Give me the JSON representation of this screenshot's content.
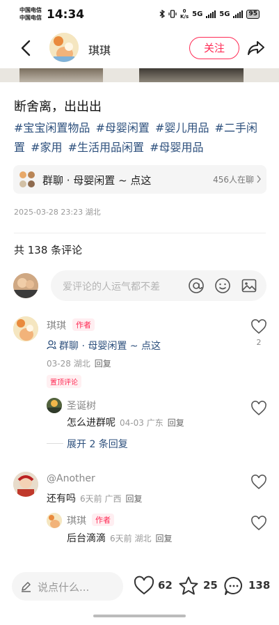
{
  "status": {
    "carrier1": "中国电信",
    "carrier2": "中国电信",
    "time": "14:34",
    "net_speed": "0",
    "net_unit": "K/s",
    "net1": "5G",
    "net2": "5G",
    "battery": "95"
  },
  "header": {
    "author_name": "琪琪",
    "follow_label": "关注"
  },
  "post": {
    "title": "断舍离，出出出",
    "tags": [
      "#宝宝闲置物品",
      "#母婴闲置",
      "#婴儿用品",
      "#二手闲置",
      "#家用",
      "#生活用品闲置",
      "#母婴用品"
    ],
    "group_title": "群聊 · 母婴闲置 ~ 点这",
    "group_count": "456人在聊",
    "meta": "2025-03-28 23:23 湖北"
  },
  "comments_section": {
    "count_label": "共 138 条评论",
    "input_placeholder": "爱评论的人运气都不差"
  },
  "comments": [
    {
      "name": "琪琪",
      "author_tag": "作者",
      "link": "群聊 · 母婴闲置 ~ 点这",
      "date": "03-28",
      "location": "湖北",
      "reply_label": "回复",
      "pinned_label": "置顶评论",
      "likes": "2"
    },
    {
      "name": "圣诞树",
      "text": "怎么进群呢",
      "date": "04-03",
      "location": "广东",
      "reply_label": "回复"
    },
    {
      "expand_label": "展开 2 条回复"
    },
    {
      "name": "@Another",
      "text": "还有吗",
      "date": "6天前",
      "location": "广西",
      "reply_label": "回复"
    },
    {
      "name": "琪琪",
      "author_tag": "作者",
      "text": "后台滴滴",
      "date": "6天前",
      "location": "湖北",
      "reply_label": "回复"
    }
  ],
  "bottom_bar": {
    "say_placeholder": "说点什么...",
    "likes": "62",
    "stars": "25",
    "comments": "138"
  },
  "colors": {
    "accent": "#ff2b55",
    "tag_blue": "#2c4f7c",
    "muted": "#999999"
  },
  "icons": [
    "back-icon",
    "share-icon",
    "at-icon",
    "emoji-icon",
    "image-icon",
    "heart-icon",
    "star-icon",
    "comment-icon",
    "pencil-icon",
    "chevron-right-icon",
    "group-chat-icon"
  ]
}
